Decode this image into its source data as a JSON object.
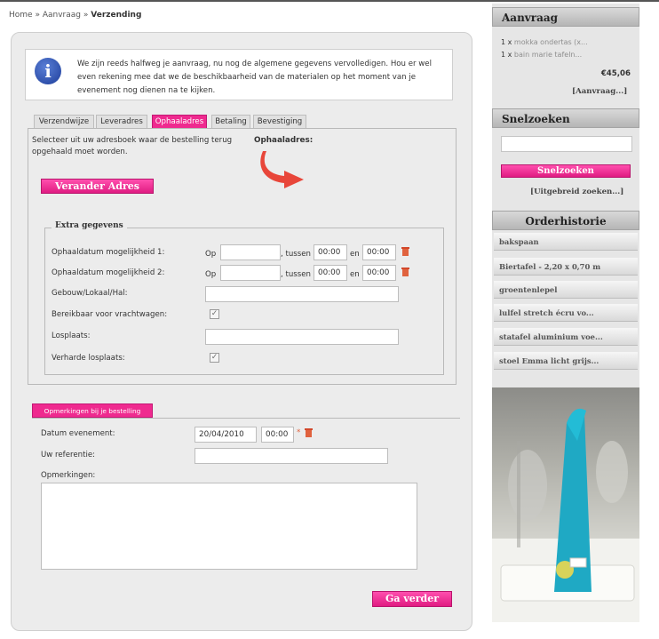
{
  "breadcrumb": {
    "home": "Home",
    "sep1": "»",
    "aanvraag": "Aanvraag",
    "sep2": "»",
    "current": "Verzending"
  },
  "info": {
    "text": "We zijn reeds halfweg je aanvraag, nu nog de algemene gegevens vervolledigen. Hou er wel even rekening mee dat we de beschikbaarheid van de materialen op het moment van je evenement nog dienen na te kijken."
  },
  "tabs": [
    {
      "label": "Verzendwijze"
    },
    {
      "label": "Leveradres"
    },
    {
      "label": "Ophaaladres"
    },
    {
      "label": "Betaling"
    },
    {
      "label": "Bevestiging"
    }
  ],
  "ophaal": {
    "select_text": "Selecteer uit uw adresboek waar de bestelling terug opgehaald moet worden.",
    "address_label": "Ophaaladres:",
    "change_button": "Verander Adres"
  },
  "extra": {
    "legend": "Extra gegevens",
    "row1_label": "Ophaaldatum mogelijkheid 1:",
    "row2_label": "Ophaaldatum mogelijkheid 2:",
    "op": "Op",
    "tussen": ", tussen",
    "en": "en",
    "time_from": "00:00",
    "time_to": "00:00",
    "gebouw_label": "Gebouw/Lokaal/Hal:",
    "bereikbaar_label": "Bereikbaar voor vrachtwagen:",
    "losplaats_label": "Losplaats:",
    "verharde_label": "Verharde losplaats:",
    "check_mark": "✓"
  },
  "opmerkingen": {
    "tab_label": "Opmerkingen bij je bestelling",
    "datum_label": "Datum evenement:",
    "datum_value": "20/04/2010",
    "time_value": "00:00",
    "referentie_label": "Uw referentie:",
    "opmerkingen_label": "Opmerkingen:",
    "next_button": "Ga verder"
  },
  "sidebar": {
    "aanvraag_title": "Aanvraag",
    "items": [
      {
        "qty": "1 x",
        "name": "mokka ondertas (x..."
      },
      {
        "qty": "1 x",
        "name": "bain marie tafeln..."
      }
    ],
    "total": "€45,06",
    "aanvraag_link": "[Aanvraag...]",
    "snelzoeken_title": "Snelzoeken",
    "snelzoeken_button": "Snelzoeken",
    "uitgebreid_link": "[Uitgebreid zoeken...]",
    "orderhistorie_title": "Orderhistorie",
    "history": [
      "bakspaan",
      "Biertafel - 2,20 x 0,70 m",
      "groentenlepel",
      "lulfel stretch écru vo...",
      "statafel aluminium voe...",
      "stoel Emma licht grijs..."
    ]
  },
  "colors": {
    "accent": "#ef2a8f",
    "panel": "#ececec",
    "sidebar": "#e6e6e6"
  }
}
